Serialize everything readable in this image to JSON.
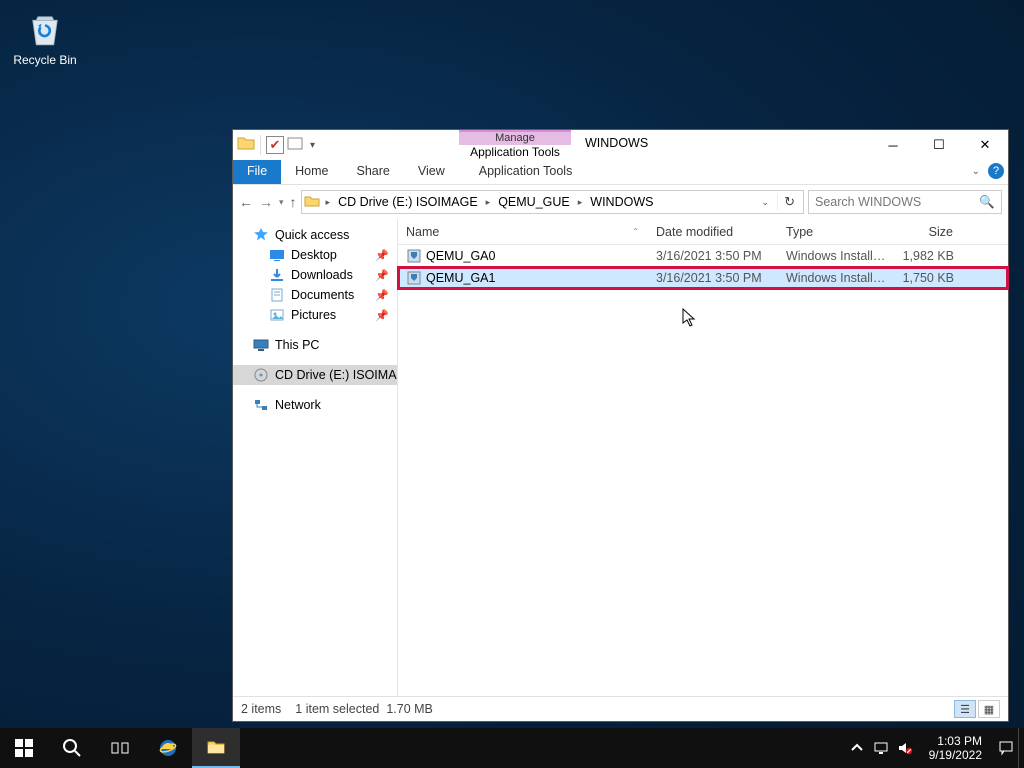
{
  "desktop": {
    "recycle_bin": "Recycle Bin"
  },
  "window": {
    "manage_label": "Manage",
    "app_tools_label": "Application Tools",
    "title": "WINDOWS",
    "ribbon": {
      "file": "File",
      "home": "Home",
      "share": "Share",
      "view": "View",
      "app_tools": "Application Tools"
    },
    "breadcrumb": {
      "root": "CD Drive (E:) ISOIMAGE",
      "seg1": "QEMU_GUE",
      "seg2": "WINDOWS"
    },
    "search_placeholder": "Search WINDOWS",
    "nav": {
      "quick_access": "Quick access",
      "desktop": "Desktop",
      "downloads": "Downloads",
      "documents": "Documents",
      "pictures": "Pictures",
      "this_pc": "This PC",
      "cd_drive": "CD Drive (E:) ISOIMAGE",
      "network": "Network"
    },
    "columns": {
      "name": "Name",
      "date": "Date modified",
      "type": "Type",
      "size": "Size"
    },
    "files": [
      {
        "name": "QEMU_GA0",
        "date": "3/16/2021 3:50 PM",
        "type": "Windows Installer ...",
        "size": "1,982 KB"
      },
      {
        "name": "QEMU_GA1",
        "date": "3/16/2021 3:50 PM",
        "type": "Windows Installer ...",
        "size": "1,750 KB"
      }
    ],
    "status": {
      "count": "2 items",
      "selection": "1 item selected",
      "size": "1.70 MB"
    }
  },
  "taskbar": {
    "time": "1:03 PM",
    "date": "9/19/2022"
  }
}
